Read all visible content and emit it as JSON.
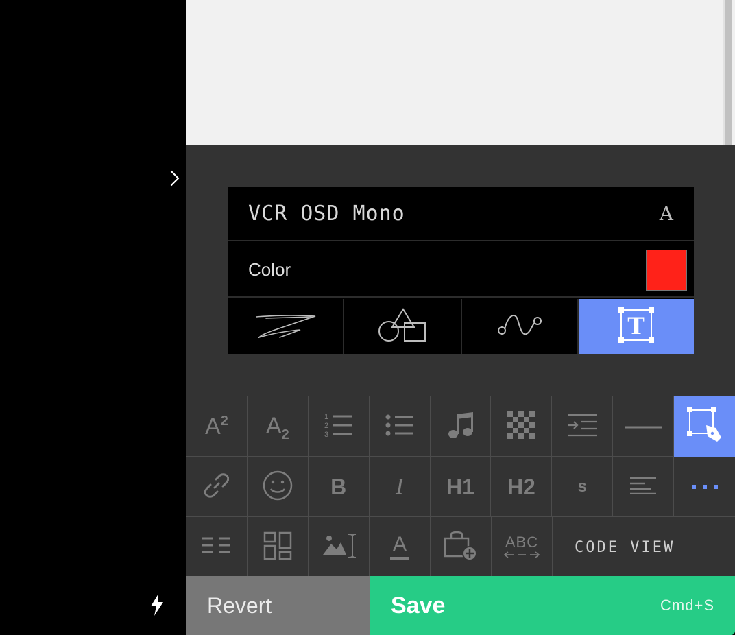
{
  "style_panel": {
    "font_name": "VCR OSD Mono",
    "font_glyph": "A",
    "color_label": "Color",
    "color_value": "#ff2219",
    "modes": [
      {
        "icon": "freehand-draw-icon",
        "active": false
      },
      {
        "icon": "shapes-icon",
        "active": false
      },
      {
        "icon": "curve-path-icon",
        "active": false
      },
      {
        "icon": "text-box-icon",
        "active": true
      }
    ]
  },
  "toolbar": {
    "row1": [
      "superscript-icon",
      "subscript-icon",
      "ordered-list-icon",
      "unordered-list-icon",
      "music-note-icon",
      "checkerboard-icon",
      "indent-icon",
      "horizontal-rule-icon",
      "draw-pen-icon"
    ],
    "row2": [
      "link-icon",
      "emoji-icon",
      "bold",
      "italic",
      "heading-1",
      "heading-2",
      "strikethrough-small",
      "align-left-icon",
      "more-icon"
    ],
    "row3": [
      "two-columns-icon",
      "layout-grid-icon",
      "image-text-icon",
      "text-color-icon",
      "shop-add-icon",
      "letter-spacing-icon",
      "code-view"
    ],
    "superscript_label": "A",
    "superscript_exp": "2",
    "subscript_label": "A",
    "subscript_sub": "2",
    "bold_label": "B",
    "italic_label": "I",
    "h1_label": "H1",
    "h2_label": "H2",
    "small_label": "s",
    "text_color_label": "A",
    "letter_spacing_label": "ABC",
    "code_view_label": "CODE VIEW"
  },
  "footer": {
    "revert_label": "Revert",
    "save_label": "Save",
    "save_shortcut": "Cmd+S"
  },
  "colors": {
    "accent": "#6a8ef8",
    "save_green": "#26cc86",
    "panel_bg": "#333333"
  }
}
